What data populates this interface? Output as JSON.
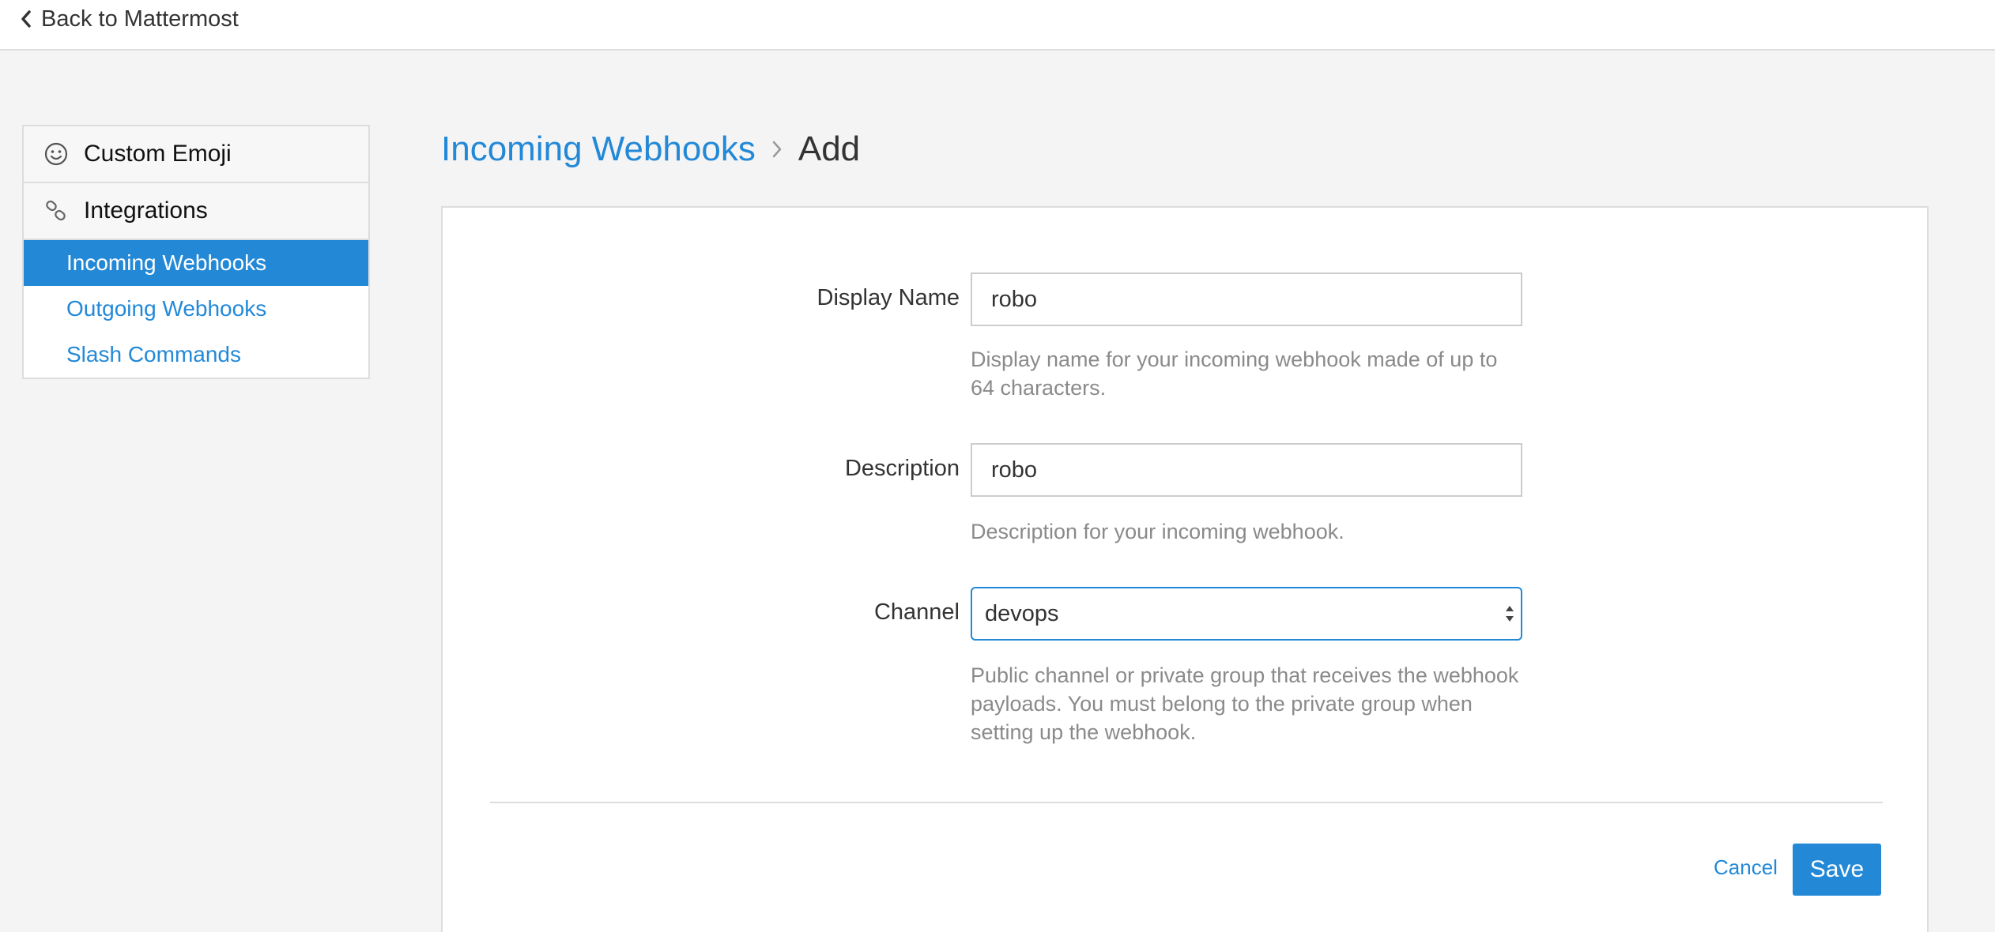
{
  "header": {
    "back_label": "Back to Mattermost",
    "back_icon": "chevron-left-icon"
  },
  "sidebar": {
    "sections": [
      {
        "label": "Custom Emoji",
        "icon": "smiley-icon"
      },
      {
        "label": "Integrations",
        "icon": "link-icon"
      }
    ],
    "items": [
      {
        "label": "Incoming Webhooks",
        "active": true
      },
      {
        "label": "Outgoing Webhooks",
        "active": false
      },
      {
        "label": "Slash Commands",
        "active": false
      }
    ]
  },
  "breadcrumb": {
    "parent": "Incoming Webhooks",
    "current": "Add"
  },
  "form": {
    "display_name": {
      "label": "Display Name",
      "value": "robo",
      "help": "Display name for your incoming webhook made of up to 64 characters."
    },
    "description": {
      "label": "Description",
      "value": "robo",
      "help": "Description for your incoming webhook."
    },
    "channel": {
      "label": "Channel",
      "value": "devops",
      "help": "Public channel or private group that receives the webhook payloads. You must belong to the private group when setting up the webhook."
    }
  },
  "actions": {
    "cancel_label": "Cancel",
    "save_label": "Save"
  },
  "colors": {
    "accent": "#2389d7",
    "background": "#f4f4f4",
    "help_text": "#8a8a8a"
  }
}
